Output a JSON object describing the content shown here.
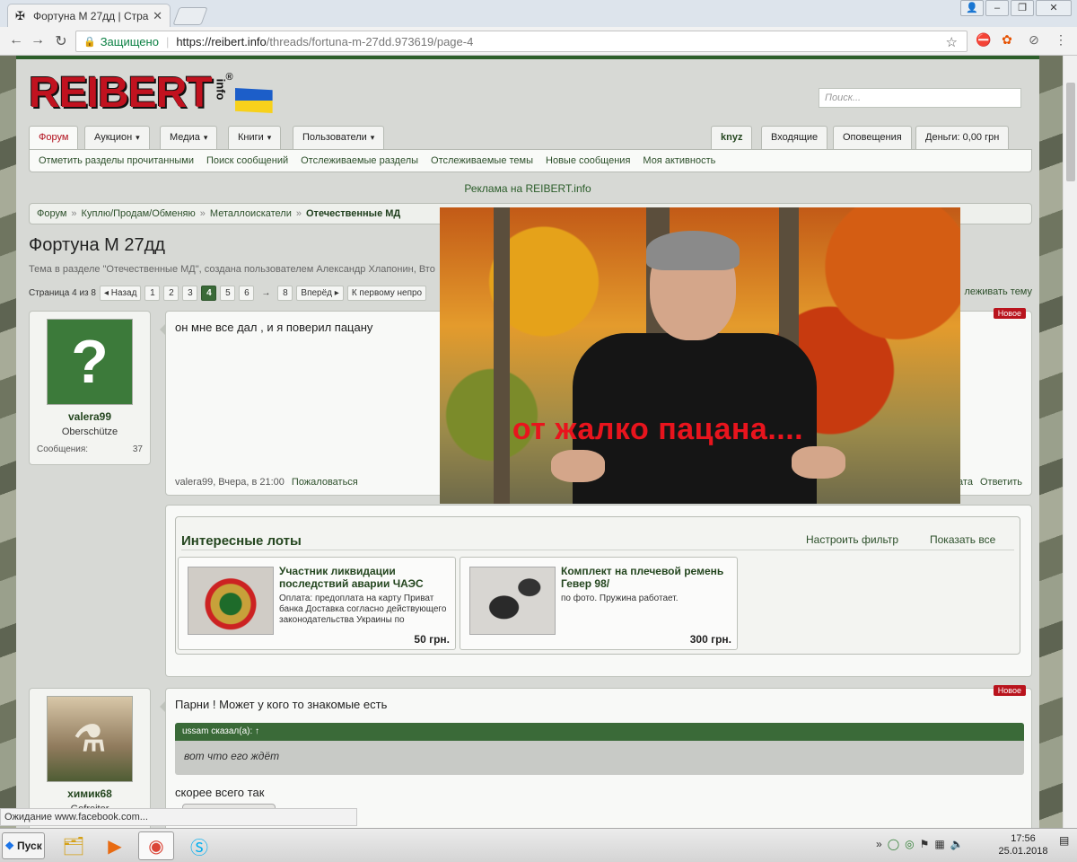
{
  "browser": {
    "tab_title": "Фортуна М 27дд | Стран",
    "tab_icon": "site-favicon-icon",
    "secure_label": "Защищено",
    "url_host": "https://reibert.info",
    "url_path": "/threads/fortuna-m-27dd.973619/page-4",
    "status_text": "Ожидание www.facebook.com..."
  },
  "site": {
    "logo_text": "REIBERT",
    "logo_suffix": "info",
    "logo_reg": "®",
    "search_placeholder": "Поиск...",
    "nav_tabs_left": [
      "Форум",
      "Аукцион",
      "Медиа",
      "Книги",
      "Пользователи"
    ],
    "nav_tabs_right": [
      "knyz",
      "Входящие",
      "Оповещения",
      "Деньги: 0,00 грн"
    ],
    "subnav": [
      "Отметить разделы прочитанными",
      "Поиск сообщений",
      "Отслеживаемые разделы",
      "Отслеживаемые темы",
      "Новые сообщения",
      "Моя активность"
    ],
    "ad_line": "Реклама на REIBERT.info",
    "breadcrumb": [
      "Форум",
      "Куплю/Продам/Обменяю",
      "Металлоискатели",
      "Отечественные МД"
    ]
  },
  "thread": {
    "title": "Фортуна М 27дд",
    "meta": "Тема в разделе \"Отечественные МД\", создана пользователем Александр Хлапонин, Вто",
    "page_label": "Страница 4 из 8",
    "prev_label": "◂ Назад",
    "pages": [
      "1",
      "2",
      "3",
      "4",
      "5",
      "6",
      "→",
      "8"
    ],
    "next_label": "Вперёд ▸",
    "first_unread": "К первому непро",
    "watch_label": "леживать тему"
  },
  "posts": [
    {
      "username": "valera99",
      "user_title": "Oberschütze",
      "stat_label": "Сообщения:",
      "stat_value": "37",
      "badge": "Новое",
      "text": "он мне все дал , и я поверил пацану",
      "footer_author": "valera99, Вчера, в 21:00",
      "report": "Пожаловаться",
      "footer_partial": "ата",
      "reply": "Ответить"
    },
    {
      "username": "химик68",
      "user_title": "Gefreiter",
      "badge": "Новое",
      "text": "Парни ! Может у кого то знакомые есть",
      "quote_head": "ussam сказал(а): ↑",
      "quote_text": "вот что его ждёт",
      "text2": "скорее всего так"
    }
  ],
  "lots": {
    "title": "Интересные лоты",
    "filter_link": "Настроить фильтр",
    "show_all_link": "Показать все",
    "items": [
      {
        "name": "Участник ликвидации последствий аварии ЧАЭС",
        "desc": "Оплата: предоплата на карту Приват банка Доставка согласно действующего законодательства Украины по",
        "price": "50 грн."
      },
      {
        "name": "Комплект на плечевой ремень Гевер 98/",
        "desc": "по фото. Пружина работает.",
        "price": "300 грн."
      }
    ]
  },
  "video": {
    "caption": "от жалко пацана...."
  },
  "taskbar": {
    "start_label": "Пуск",
    "time": "17:56",
    "date": "25.01.2018"
  },
  "colors": {
    "accent_green": "#2c5e2a",
    "logo_red": "#c1121f",
    "badge_red": "#b9141d"
  }
}
